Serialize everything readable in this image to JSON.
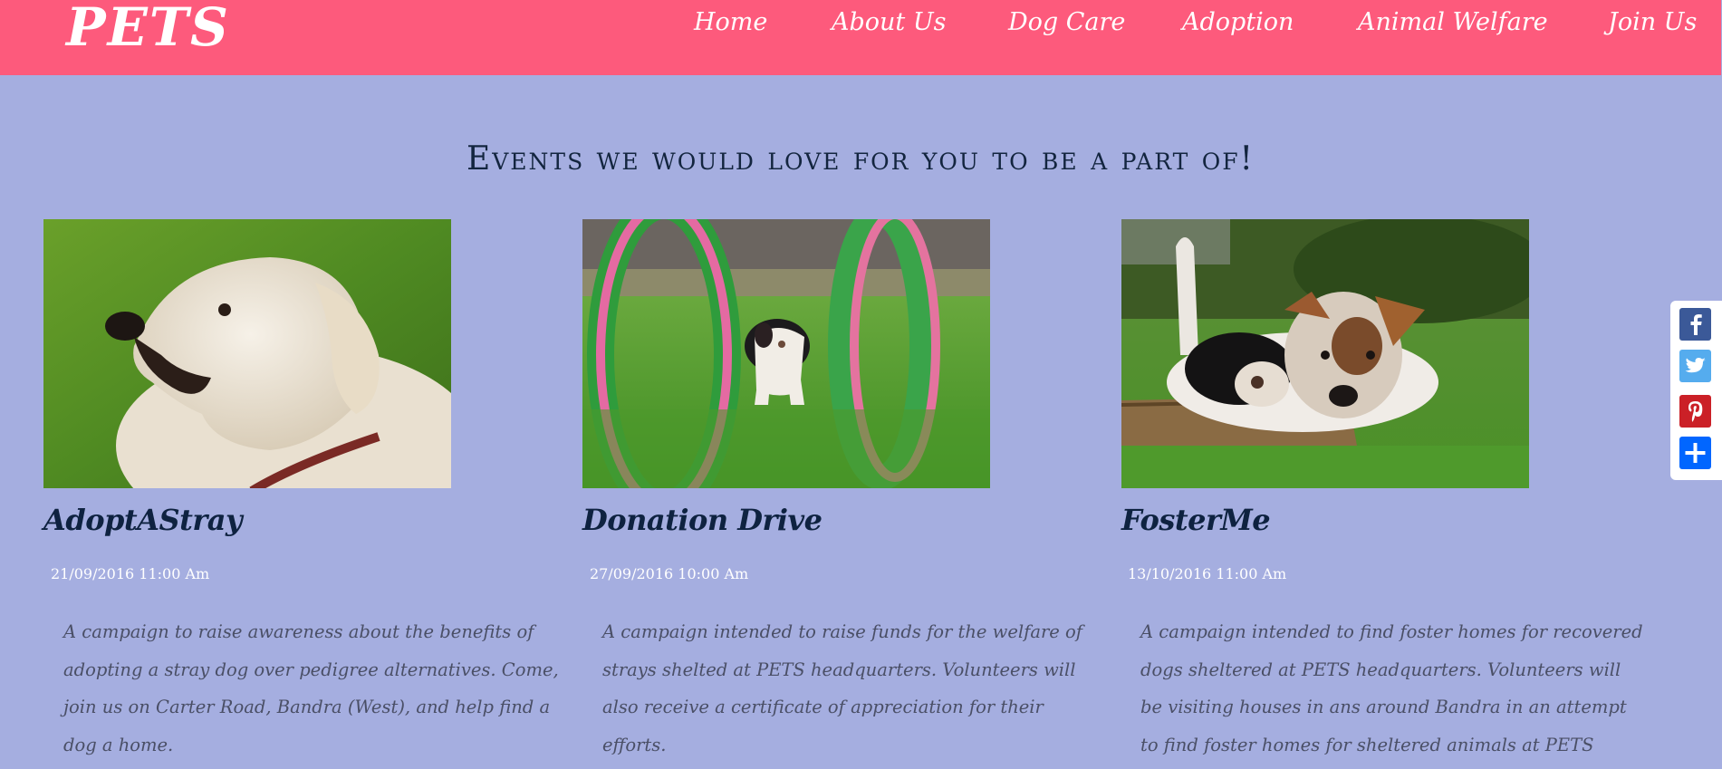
{
  "brand": {
    "name": "PETS"
  },
  "nav": {
    "items": [
      {
        "label": "Home"
      },
      {
        "label": "About Us"
      },
      {
        "label": "Dog Care"
      },
      {
        "label": "Adoption"
      },
      {
        "label": "Animal Welfare"
      },
      {
        "label": "Join Us"
      }
    ]
  },
  "events": {
    "heading": "Events we would love for you to be a part of!",
    "cards": [
      {
        "title": "AdoptAStray",
        "date": "21/09/2016 11:00 Am",
        "description": "A campaign to raise awareness about the benefits of adopting a stray dog over pedigree alternatives. Come, join us on Carter Road, Bandra (West), and help find a dog a home."
      },
      {
        "title": "Donation Drive",
        "date": "27/09/2016 10:00 Am",
        "description": "A campaign intended to raise funds for the welfare of strays shelted at PETS headquarters. Volunteers will also receive a certificate of appreciation for their efforts."
      },
      {
        "title": "FosterMe",
        "date": "13/10/2016 11:00 Am",
        "description": "A campaign intended to find foster homes for recovered dogs sheltered at PETS headquarters. Volunteers will be visiting houses in ans around Bandra in an attempt to find foster homes for sheltered animals at PETS headquarters."
      }
    ]
  },
  "share": {
    "buttons": [
      {
        "icon": "facebook-icon",
        "color": "#3b5998"
      },
      {
        "icon": "twitter-icon",
        "color": "#55acee"
      },
      {
        "icon": "pinterest-icon",
        "color": "#cb2027"
      },
      {
        "icon": "share-plus-icon",
        "color": "#0166ff"
      }
    ]
  },
  "colors": {
    "navbar": "#fd5a7c",
    "background": "#a5aee0",
    "heading": "#13253f"
  }
}
